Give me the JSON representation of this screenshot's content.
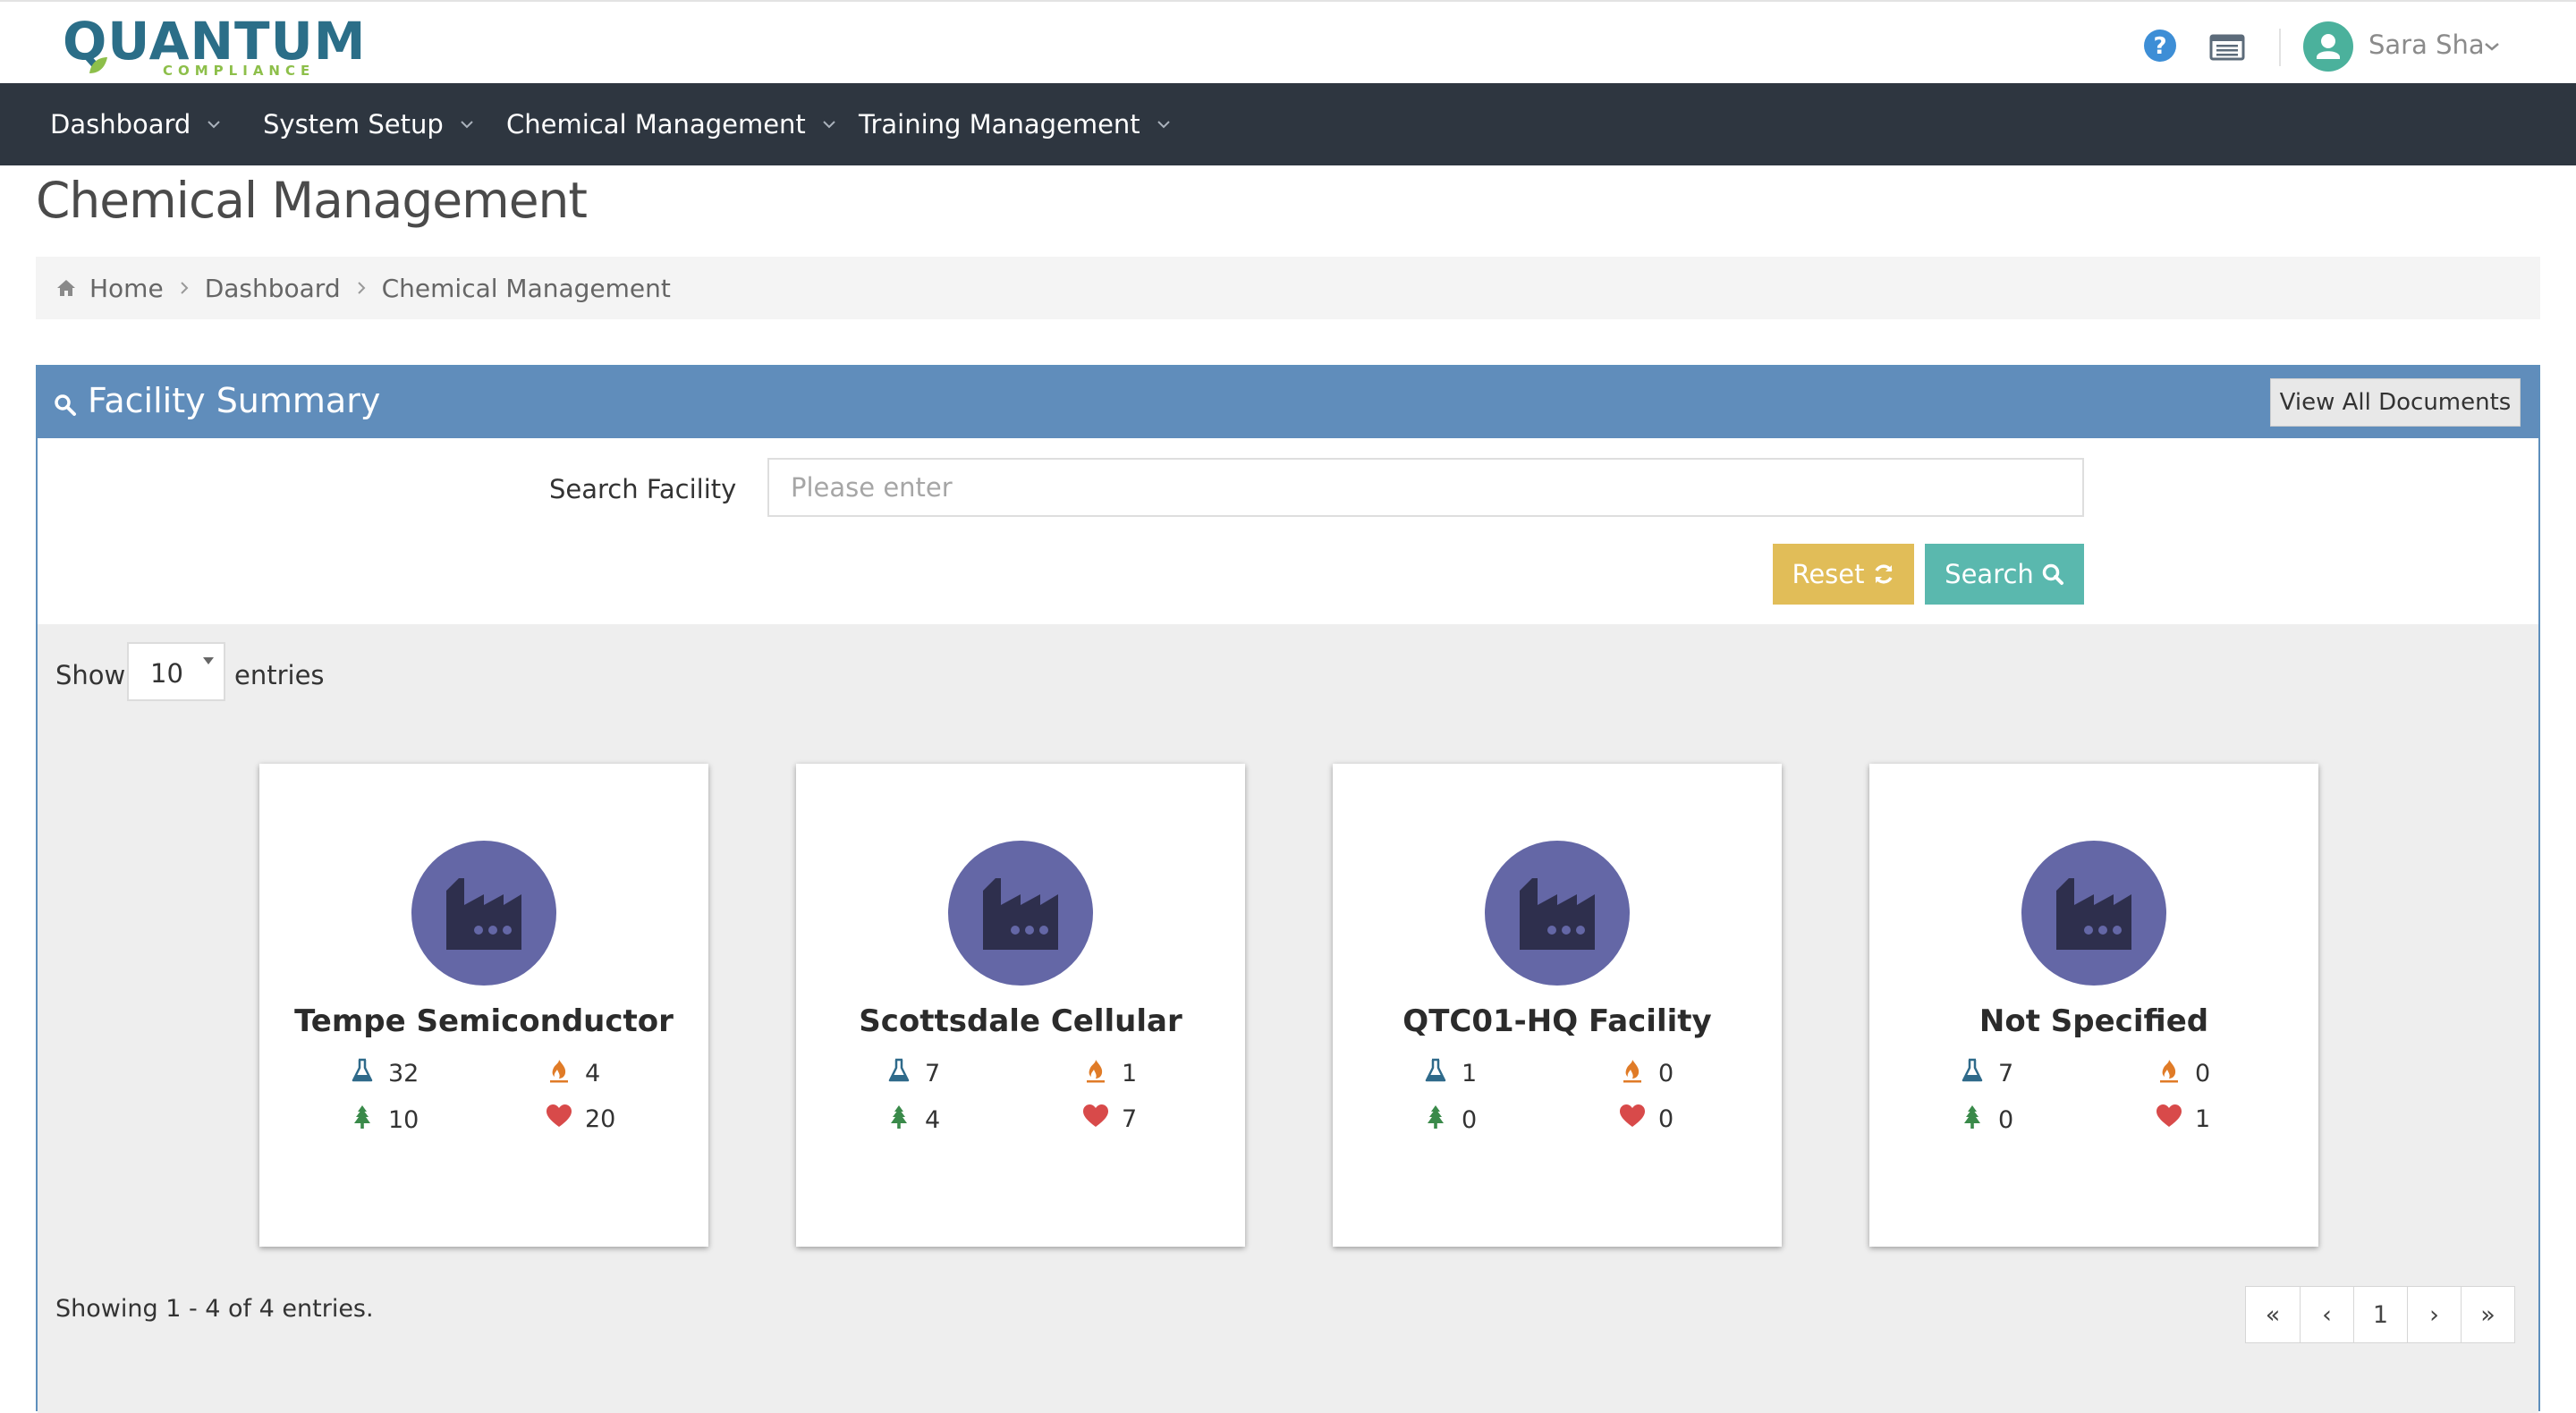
{
  "app": {
    "logo_main": "QUANTUM",
    "logo_sub": "COMPLIANCE",
    "user_name": "Sara Sha"
  },
  "nav": {
    "items": [
      {
        "label": "Dashboard"
      },
      {
        "label": "System Setup"
      },
      {
        "label": "Chemical Management"
      },
      {
        "label": "Training Management"
      }
    ]
  },
  "page": {
    "title": "Chemical Management",
    "breadcrumb": [
      "Home",
      "Dashboard",
      "Chemical Management"
    ]
  },
  "panel": {
    "title": "Facility Summary",
    "view_all_label": "View All Documents",
    "search_label": "Search Facility",
    "search_placeholder": "Please enter",
    "search_value": "",
    "reset_label": "Reset",
    "search_button_label": "Search"
  },
  "entries": {
    "show_label": "Show",
    "value": "10",
    "entries_label": "entries"
  },
  "facilities": [
    {
      "name": "Tempe Semiconductor",
      "chemicals": "32",
      "flammable": "4",
      "environmental": "10",
      "health": "20"
    },
    {
      "name": "Scottsdale Cellular",
      "chemicals": "7",
      "flammable": "1",
      "environmental": "4",
      "health": "7"
    },
    {
      "name": "QTC01-HQ Facility",
      "chemicals": "1",
      "flammable": "0",
      "environmental": "0",
      "health": "0"
    },
    {
      "name": "Not Specified",
      "chemicals": "7",
      "flammable": "0",
      "environmental": "0",
      "health": "1"
    }
  ],
  "footer": {
    "showing_text": "Showing 1 - 4 of 4 entries.",
    "pagination": [
      "«",
      "‹",
      "1",
      "›",
      "»"
    ]
  },
  "colors": {
    "navbar": "#2e3640",
    "panel_header": "#608dbb",
    "reset": "#e1bd58",
    "search": "#5ab8ae",
    "facility_circle": "#6467a6"
  },
  "icons": {
    "chemicals": "flask-icon",
    "flammable": "flame-icon",
    "environmental": "tree-icon",
    "health": "heart-icon"
  }
}
